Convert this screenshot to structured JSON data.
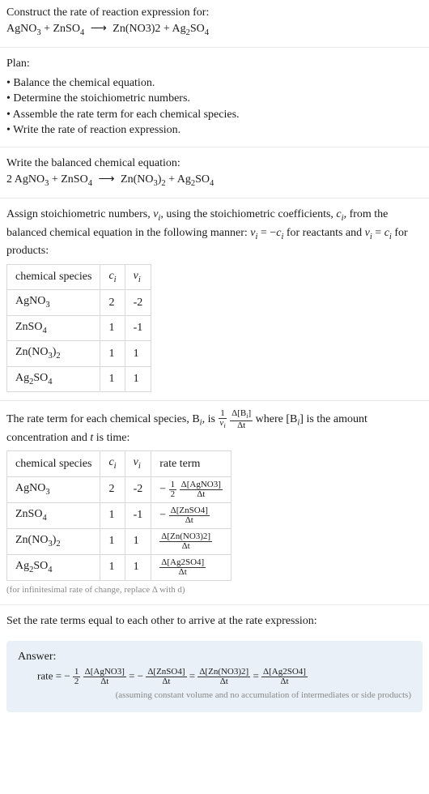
{
  "prompt": {
    "lead": "Construct the rate of reaction expression for:",
    "unbalanced_lhs": "AgNO",
    "plus": " + ",
    "znso4": "ZnSO",
    "arrow": "⟶",
    "zn_no3_2": "Zn(NO3)2",
    "ag2so4": "Ag"
  },
  "plan": {
    "heading": "Plan:",
    "items": [
      "Balance the chemical equation.",
      "Determine the stoichiometric numbers.",
      "Assemble the rate term for each chemical species.",
      "Write the rate of reaction expression."
    ]
  },
  "balanced": {
    "heading": "Write the balanced chemical equation:",
    "coef_agno3": "2"
  },
  "assign": {
    "text_pre": "Assign stoichiometric numbers, ",
    "nu": "ν",
    "text_mid1": ", using the stoichiometric coefficients, ",
    "c": "c",
    "text_mid2": ", from the balanced chemical equation in the following manner: ",
    "rel_reactants": " = −",
    "text_react": " for reactants and ",
    "rel_products": " = ",
    "text_prod": " for products:"
  },
  "table1": {
    "headers": {
      "species": "chemical species",
      "ci": "c",
      "nui": "ν"
    },
    "rows": [
      {
        "species": "AgNO₃",
        "ci": "2",
        "nui": "-2"
      },
      {
        "species": "ZnSO₄",
        "ci": "1",
        "nui": "-1"
      },
      {
        "species": "Zn(NO₃)₂",
        "ci": "1",
        "nui": "1"
      },
      {
        "species": "Ag₂SO₄",
        "ci": "1",
        "nui": "1"
      }
    ]
  },
  "rate_intro": {
    "part1": "The rate term for each chemical species, B",
    "part2": ", is ",
    "part3": " where [B",
    "part4": "] is the amount concentration and ",
    "t": "t",
    "part5": " is time:"
  },
  "table2": {
    "headers": {
      "species": "chemical species",
      "ci": "c",
      "nui": "ν",
      "rate": "rate term"
    },
    "rows": [
      {
        "species": "AgNO₃",
        "ci": "2",
        "nui": "-2",
        "coef": "−",
        "half_num": "1",
        "half_den": "2",
        "d_species": "Δ[AgNO3]",
        "dt": "Δt"
      },
      {
        "species": "ZnSO₄",
        "ci": "1",
        "nui": "-1",
        "coef": "−",
        "half_num": "",
        "half_den": "",
        "d_species": "Δ[ZnSO4]",
        "dt": "Δt"
      },
      {
        "species": "Zn(NO₃)₂",
        "ci": "1",
        "nui": "1",
        "coef": "",
        "half_num": "",
        "half_den": "",
        "d_species": "Δ[Zn(NO3)2]",
        "dt": "Δt"
      },
      {
        "species": "Ag₂SO₄",
        "ci": "1",
        "nui": "1",
        "coef": "",
        "half_num": "",
        "half_den": "",
        "d_species": "Δ[Ag2SO4]",
        "dt": "Δt"
      }
    ]
  },
  "note_infinitesimal": "(for infinitesimal rate of change, replace Δ with d)",
  "set_equal": "Set the rate terms equal to each other to arrive at the rate expression:",
  "answer": {
    "heading": "Answer:",
    "rate_label": "rate = ",
    "neg": "−",
    "half_num": "1",
    "half_den": "2",
    "d1": "Δ[AgNO3]",
    "d2": "Δ[ZnSO4]",
    "d3": "Δ[Zn(NO3)2]",
    "d4": "Δ[Ag2SO4]",
    "dt": "Δt",
    "eq": " = ",
    "caveat": "(assuming constant volume and no accumulation of intermediates or side products)"
  },
  "frac_generic": {
    "one_over_nu_num": "1",
    "one_over_nu_den": "ν",
    "dBi_num": "Δ[B",
    "dBi_num_close": "]",
    "dBi_den": "Δt"
  }
}
